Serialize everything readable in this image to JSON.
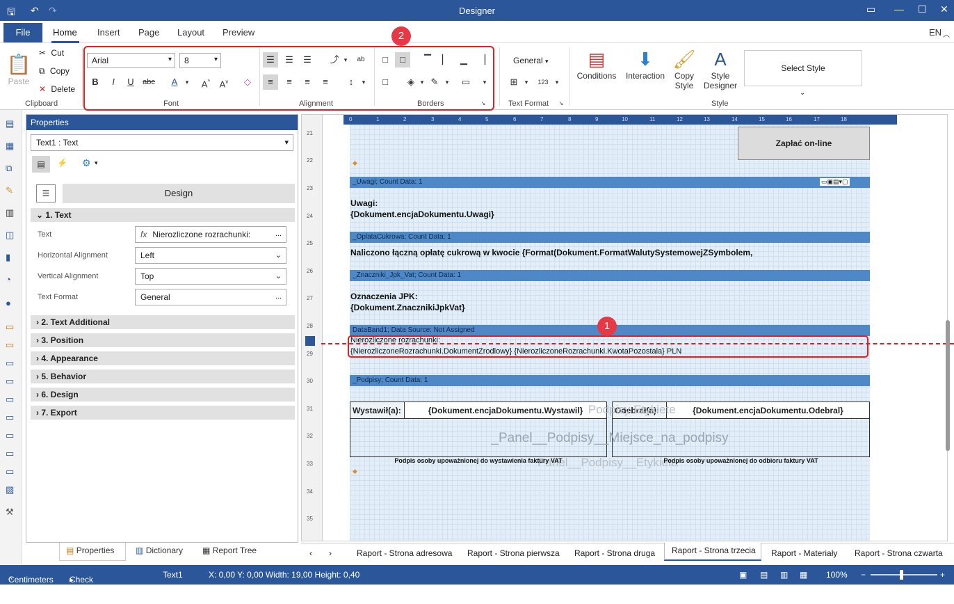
{
  "window": {
    "title": "Designer"
  },
  "menu": {
    "file": "File",
    "tabs": [
      "Home",
      "Insert",
      "Page",
      "Layout",
      "Preview"
    ],
    "lang": "EN"
  },
  "clipboard": {
    "paste": "Paste",
    "cut": "Cut",
    "copy": "Copy",
    "delete": "Delete",
    "label": "Clipboard"
  },
  "font": {
    "family": "Arial",
    "size": "8",
    "label": "Font"
  },
  "alignment": {
    "label": "Alignment"
  },
  "borders": {
    "label": "Borders"
  },
  "textformat": {
    "value": "General",
    "label": "Text Format"
  },
  "ribbon_big": {
    "conditions": "Conditions",
    "interaction": "Interaction",
    "copy_style": "Copy Style",
    "style_designer": "Style Designer",
    "style_label": "Style",
    "select_style": "Select Style"
  },
  "badges": {
    "one": "1",
    "two": "2"
  },
  "properties": {
    "title": "Properties",
    "object": "Text1 : Text",
    "design": "Design",
    "section1": "1. Text",
    "rows": [
      {
        "label": "Text",
        "value": "Nierozliczone rozrachunki:"
      },
      {
        "label": "Horizontal Alignment",
        "value": "Left"
      },
      {
        "label": "Vertical Alignment",
        "value": "Top"
      },
      {
        "label": "Text Format",
        "value": "General"
      }
    ],
    "sections": [
      "2. Text Additional",
      "3. Position",
      "4. Appearance",
      "5. Behavior",
      "6. Design",
      "7. Export"
    ],
    "fx": "fx",
    "ellipsis": "..."
  },
  "paneltabs": [
    "Properties",
    "Dictionary",
    "Report Tree"
  ],
  "ruler": {
    "v": [
      "21",
      "22",
      "23",
      "24",
      "25",
      "26",
      "27",
      "28",
      "29",
      "30",
      "31",
      "32",
      "33",
      "34",
      "35"
    ],
    "h": [
      "0",
      "1",
      "2",
      "3",
      "4",
      "5",
      "6",
      "7",
      "8",
      "9",
      "10",
      "11",
      "12",
      "13",
      "14",
      "15",
      "16",
      "17",
      "18"
    ]
  },
  "report": {
    "pay": "Zapłać on-line",
    "band_uwagi": "_Uwagi; Count Data: 1",
    "uwagi1": "Uwagi:",
    "uwagi2": "{Dokument.encjaDokumentu.Uwagi}",
    "band_oplata": "_OplataCukrowa; Count Data: 1",
    "oplata": "Naliczono łączną opłatę cukrową w kwocie {Format(Dokument.FormatWalutySystemowejZSymbolem,",
    "band_jpk": "_Znaczniki_Jpk_Vat; Count Data: 1",
    "jpk1": "Oznaczenia JPK:",
    "jpk2": "{Dokument.ZnacznikiJpkVat}",
    "band_data": "DataBand1; Data Source: Not Assigned",
    "nier1": "Nierozliczone rozrachunki:",
    "nier2": "{NierozliczoneRozrachunki.DokumentZrodlowy} {NierozliczoneRozrachunki.KwotaPozostala} PLN",
    "band_podpisy": "_Podpisy; Count Data: 1",
    "wystawil": "Wystawił(a):",
    "wystawil_val": "{Dokument.encjaDokumentu.Wystawil}",
    "odebral": "Odebrał(a):",
    "odebral_val": "{Dokument.encjaDokumentu.Odebral}",
    "panel_text": "_Panel__Podpisy__Miejsce_na_podpisy",
    "ghost1": "Podpisy  Etykiete",
    "ghost2": "Panel__Podpisy__Etykieta",
    "sig_left": "Podpis osoby upoważnionej do wystawienia faktury VAT",
    "sig_right": "Podpis osoby upoważnionej do odbioru faktury VAT"
  },
  "pagetabs": [
    "Raport - Strona adresowa",
    "Raport - Strona pierwsza",
    "Raport - Strona druga",
    "Raport - Strona trzecia",
    "Raport - Materiały",
    "Raport - Strona czwarta"
  ],
  "status": {
    "units": "Centimeters",
    "check": "Check for Issues",
    "object": "Text1",
    "coords": "X: 0,00  Y: 0,00  Width: 19,00  Height: 0,40",
    "zoom": "100%"
  }
}
